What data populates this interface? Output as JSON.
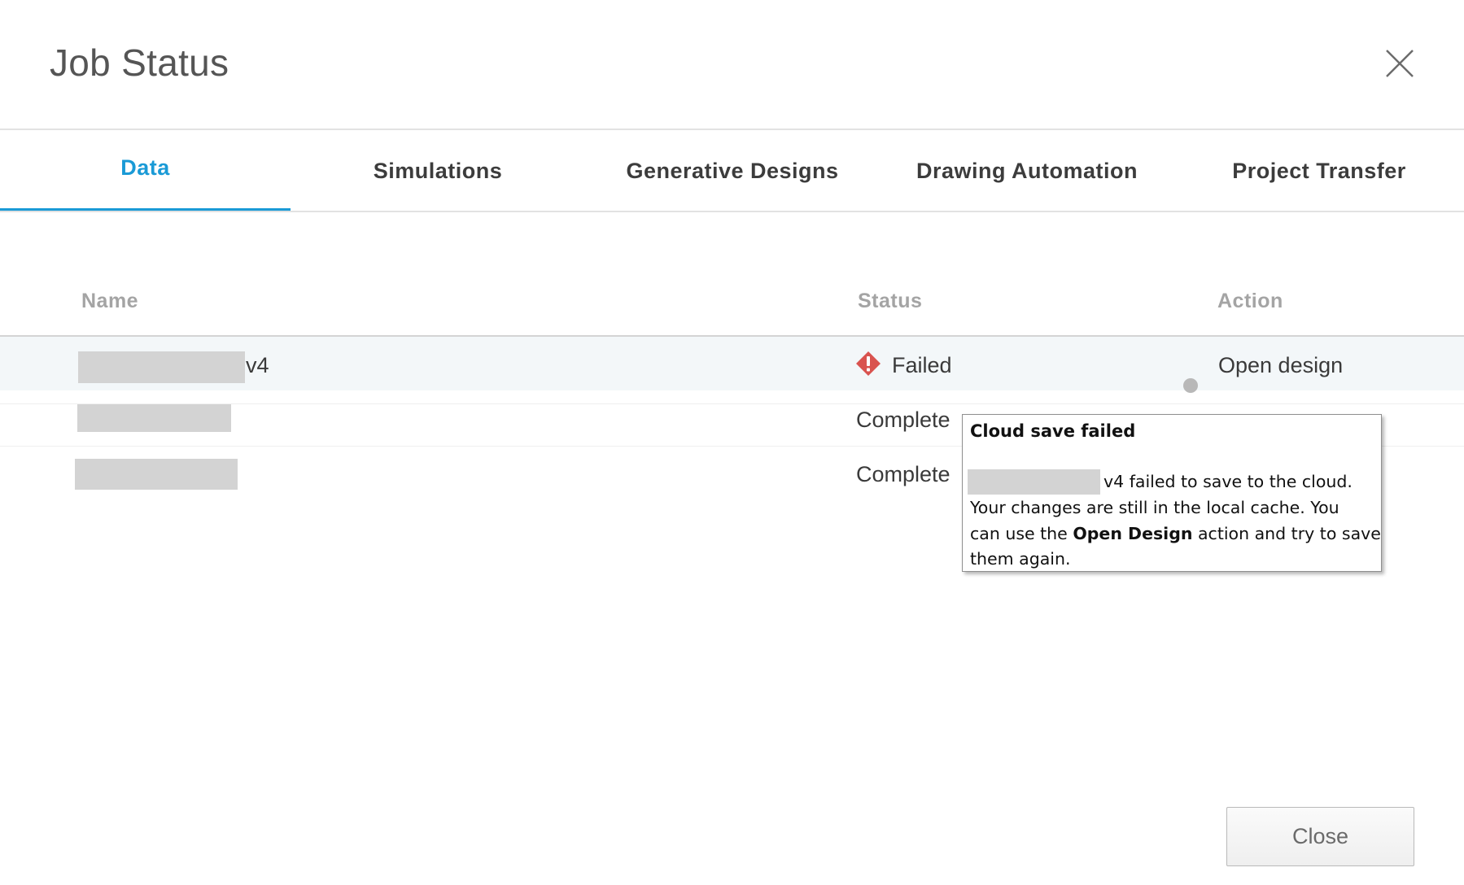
{
  "dialog": {
    "title": "Job Status",
    "close_icon": "close-icon"
  },
  "tabs": [
    {
      "label": "Data",
      "active": true
    },
    {
      "label": "Simulations",
      "active": false
    },
    {
      "label": "Generative Designs",
      "active": false
    },
    {
      "label": "Drawing Automation",
      "active": false
    },
    {
      "label": "Project Transfer",
      "active": false
    }
  ],
  "table": {
    "headers": {
      "name": "Name",
      "status": "Status",
      "action": "Action"
    },
    "rows": [
      {
        "name_suffix": "v4",
        "status": "Failed",
        "status_icon": "error-diamond-icon",
        "action": "Open design"
      },
      {
        "name_suffix": "",
        "status": "Complete",
        "action": ""
      },
      {
        "name_suffix": "",
        "status": "Complete",
        "action": ""
      }
    ]
  },
  "tooltip": {
    "title": "Cloud save failed",
    "line1": "v4 failed to save to the cloud.",
    "line2": "Your changes are still in the local cache. You",
    "line3_pre": "can use the ",
    "line3_bold": "Open Design",
    "line3_post": " action and try to save",
    "line4": "them again."
  },
  "footer": {
    "close_label": "Close"
  },
  "colors": {
    "accent": "#1a9ad6",
    "error": "#d9534f"
  }
}
